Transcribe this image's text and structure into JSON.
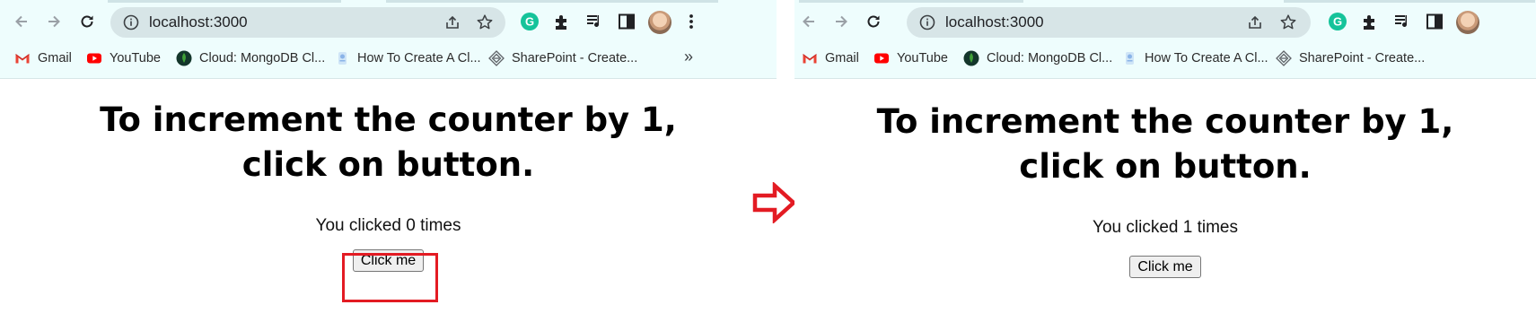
{
  "before": {
    "browser": {
      "url": "localhost:3000",
      "bookmarks": [
        {
          "label": "Gmail",
          "icon": "gmail-icon"
        },
        {
          "label": "YouTube",
          "icon": "youtube-icon"
        },
        {
          "label": "Cloud: MongoDB Cl...",
          "icon": "mongodb-icon"
        },
        {
          "label": "How To Create A Cl...",
          "icon": "article-icon"
        },
        {
          "label": "SharePoint - Create...",
          "icon": "sharepoint-icon"
        }
      ],
      "more_label": "»"
    },
    "page": {
      "heading": "To increment the counter by 1, click on button.",
      "count_text": "You clicked 0 times",
      "button_label": "Click me"
    }
  },
  "after": {
    "browser": {
      "url": "localhost:3000",
      "bookmarks": [
        {
          "label": "Gmail",
          "icon": "gmail-icon"
        },
        {
          "label": "YouTube",
          "icon": "youtube-icon"
        },
        {
          "label": "Cloud: MongoDB Cl...",
          "icon": "mongodb-icon"
        },
        {
          "label": "How To Create A Cl...",
          "icon": "article-icon"
        },
        {
          "label": "SharePoint - Create...",
          "icon": "sharepoint-icon"
        }
      ]
    },
    "page": {
      "heading": "To increment the counter by 1, click on button.",
      "count_text": "You clicked 1 times",
      "button_label": "Click me"
    }
  },
  "colors": {
    "highlight": "#e31b23",
    "arrow": "#e31b23",
    "chrome_bg": "#eefdfd",
    "omnibox_bg": "#d7e5e7"
  },
  "icons": {
    "back": "back-arrow-icon",
    "forward": "forward-arrow-icon",
    "reload": "reload-icon",
    "info": "info-icon",
    "share": "share-icon",
    "bookmark_star": "star-icon",
    "grammarly": "grammarly-icon",
    "extensions": "puzzle-icon",
    "media": "media-playlist-icon",
    "side_panel": "side-panel-icon",
    "menu": "kebab-menu-icon",
    "transition_arrow": "right-arrow-icon"
  }
}
